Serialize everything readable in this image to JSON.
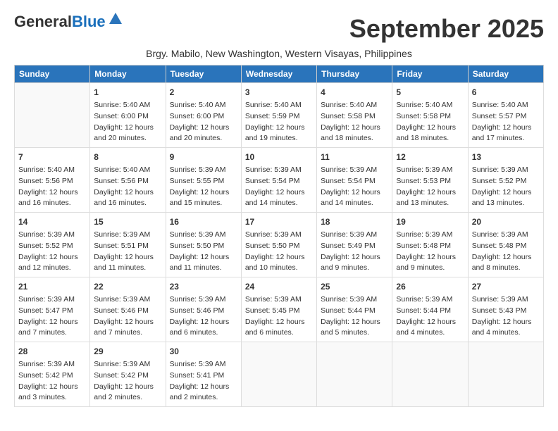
{
  "header": {
    "logo_general": "General",
    "logo_blue": "Blue",
    "month_title": "September 2025",
    "subtitle": "Brgy. Mabilo, New Washington, Western Visayas, Philippines"
  },
  "days_of_week": [
    "Sunday",
    "Monday",
    "Tuesday",
    "Wednesday",
    "Thursday",
    "Friday",
    "Saturday"
  ],
  "weeks": [
    [
      {
        "day": "",
        "sunrise": "",
        "sunset": "",
        "daylight": ""
      },
      {
        "day": "1",
        "sunrise": "Sunrise: 5:40 AM",
        "sunset": "Sunset: 6:00 PM",
        "daylight": "Daylight: 12 hours and 20 minutes."
      },
      {
        "day": "2",
        "sunrise": "Sunrise: 5:40 AM",
        "sunset": "Sunset: 6:00 PM",
        "daylight": "Daylight: 12 hours and 20 minutes."
      },
      {
        "day": "3",
        "sunrise": "Sunrise: 5:40 AM",
        "sunset": "Sunset: 5:59 PM",
        "daylight": "Daylight: 12 hours and 19 minutes."
      },
      {
        "day": "4",
        "sunrise": "Sunrise: 5:40 AM",
        "sunset": "Sunset: 5:58 PM",
        "daylight": "Daylight: 12 hours and 18 minutes."
      },
      {
        "day": "5",
        "sunrise": "Sunrise: 5:40 AM",
        "sunset": "Sunset: 5:58 PM",
        "daylight": "Daylight: 12 hours and 18 minutes."
      },
      {
        "day": "6",
        "sunrise": "Sunrise: 5:40 AM",
        "sunset": "Sunset: 5:57 PM",
        "daylight": "Daylight: 12 hours and 17 minutes."
      }
    ],
    [
      {
        "day": "7",
        "sunrise": "Sunrise: 5:40 AM",
        "sunset": "Sunset: 5:56 PM",
        "daylight": "Daylight: 12 hours and 16 minutes."
      },
      {
        "day": "8",
        "sunrise": "Sunrise: 5:40 AM",
        "sunset": "Sunset: 5:56 PM",
        "daylight": "Daylight: 12 hours and 16 minutes."
      },
      {
        "day": "9",
        "sunrise": "Sunrise: 5:39 AM",
        "sunset": "Sunset: 5:55 PM",
        "daylight": "Daylight: 12 hours and 15 minutes."
      },
      {
        "day": "10",
        "sunrise": "Sunrise: 5:39 AM",
        "sunset": "Sunset: 5:54 PM",
        "daylight": "Daylight: 12 hours and 14 minutes."
      },
      {
        "day": "11",
        "sunrise": "Sunrise: 5:39 AM",
        "sunset": "Sunset: 5:54 PM",
        "daylight": "Daylight: 12 hours and 14 minutes."
      },
      {
        "day": "12",
        "sunrise": "Sunrise: 5:39 AM",
        "sunset": "Sunset: 5:53 PM",
        "daylight": "Daylight: 12 hours and 13 minutes."
      },
      {
        "day": "13",
        "sunrise": "Sunrise: 5:39 AM",
        "sunset": "Sunset: 5:52 PM",
        "daylight": "Daylight: 12 hours and 13 minutes."
      }
    ],
    [
      {
        "day": "14",
        "sunrise": "Sunrise: 5:39 AM",
        "sunset": "Sunset: 5:52 PM",
        "daylight": "Daylight: 12 hours and 12 minutes."
      },
      {
        "day": "15",
        "sunrise": "Sunrise: 5:39 AM",
        "sunset": "Sunset: 5:51 PM",
        "daylight": "Daylight: 12 hours and 11 minutes."
      },
      {
        "day": "16",
        "sunrise": "Sunrise: 5:39 AM",
        "sunset": "Sunset: 5:50 PM",
        "daylight": "Daylight: 12 hours and 11 minutes."
      },
      {
        "day": "17",
        "sunrise": "Sunrise: 5:39 AM",
        "sunset": "Sunset: 5:50 PM",
        "daylight": "Daylight: 12 hours and 10 minutes."
      },
      {
        "day": "18",
        "sunrise": "Sunrise: 5:39 AM",
        "sunset": "Sunset: 5:49 PM",
        "daylight": "Daylight: 12 hours and 9 minutes."
      },
      {
        "day": "19",
        "sunrise": "Sunrise: 5:39 AM",
        "sunset": "Sunset: 5:48 PM",
        "daylight": "Daylight: 12 hours and 9 minutes."
      },
      {
        "day": "20",
        "sunrise": "Sunrise: 5:39 AM",
        "sunset": "Sunset: 5:48 PM",
        "daylight": "Daylight: 12 hours and 8 minutes."
      }
    ],
    [
      {
        "day": "21",
        "sunrise": "Sunrise: 5:39 AM",
        "sunset": "Sunset: 5:47 PM",
        "daylight": "Daylight: 12 hours and 7 minutes."
      },
      {
        "day": "22",
        "sunrise": "Sunrise: 5:39 AM",
        "sunset": "Sunset: 5:46 PM",
        "daylight": "Daylight: 12 hours and 7 minutes."
      },
      {
        "day": "23",
        "sunrise": "Sunrise: 5:39 AM",
        "sunset": "Sunset: 5:46 PM",
        "daylight": "Daylight: 12 hours and 6 minutes."
      },
      {
        "day": "24",
        "sunrise": "Sunrise: 5:39 AM",
        "sunset": "Sunset: 5:45 PM",
        "daylight": "Daylight: 12 hours and 6 minutes."
      },
      {
        "day": "25",
        "sunrise": "Sunrise: 5:39 AM",
        "sunset": "Sunset: 5:44 PM",
        "daylight": "Daylight: 12 hours and 5 minutes."
      },
      {
        "day": "26",
        "sunrise": "Sunrise: 5:39 AM",
        "sunset": "Sunset: 5:44 PM",
        "daylight": "Daylight: 12 hours and 4 minutes."
      },
      {
        "day": "27",
        "sunrise": "Sunrise: 5:39 AM",
        "sunset": "Sunset: 5:43 PM",
        "daylight": "Daylight: 12 hours and 4 minutes."
      }
    ],
    [
      {
        "day": "28",
        "sunrise": "Sunrise: 5:39 AM",
        "sunset": "Sunset: 5:42 PM",
        "daylight": "Daylight: 12 hours and 3 minutes."
      },
      {
        "day": "29",
        "sunrise": "Sunrise: 5:39 AM",
        "sunset": "Sunset: 5:42 PM",
        "daylight": "Daylight: 12 hours and 2 minutes."
      },
      {
        "day": "30",
        "sunrise": "Sunrise: 5:39 AM",
        "sunset": "Sunset: 5:41 PM",
        "daylight": "Daylight: 12 hours and 2 minutes."
      },
      {
        "day": "",
        "sunrise": "",
        "sunset": "",
        "daylight": ""
      },
      {
        "day": "",
        "sunrise": "",
        "sunset": "",
        "daylight": ""
      },
      {
        "day": "",
        "sunrise": "",
        "sunset": "",
        "daylight": ""
      },
      {
        "day": "",
        "sunrise": "",
        "sunset": "",
        "daylight": ""
      }
    ]
  ]
}
